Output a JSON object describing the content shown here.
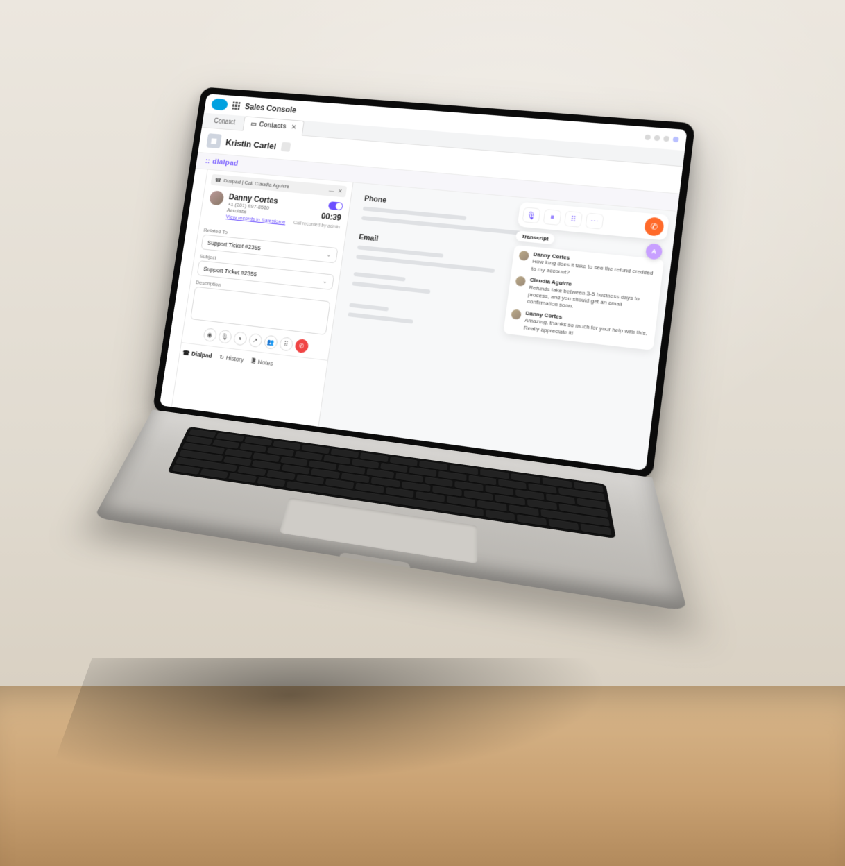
{
  "header": {
    "app_title": "Sales Console",
    "breadcrumb_label": "Conatct",
    "contact_name": "Kristin Carlel",
    "brand": "dialpad"
  },
  "tabs": {
    "active_label": "Contacts",
    "active_icon": "contact-card"
  },
  "cti": {
    "chip_label": "Dialpad | Call Claudia Aguirre",
    "caller_name": "Danny Cortes",
    "caller_phone": "+1 (201) 897-8510",
    "caller_company": "Aerolabs",
    "records_link": "View records in Salesforce",
    "timer": "00:39",
    "recorded_caption": "Call recorded by admin",
    "related_to_label": "Related To",
    "related_to_value": "Support Ticket #2355",
    "subject_label": "Subject",
    "subject_value": "Support Ticket #2355",
    "description_label": "Description",
    "bottom": {
      "dialpad": "Dialpad",
      "history": "History",
      "notes": "Notes"
    }
  },
  "center": {
    "phone_label": "Phone",
    "email_label": "Email"
  },
  "widget": {
    "transcript_label": "Transcript",
    "items": [
      {
        "name": "Danny Cortes",
        "text": "How long does it take to see the refund credited to my account?"
      },
      {
        "name": "Claudia Aguirre",
        "text": "Refunds take between 3-5 business days to process, and you should get an email confirmation soon."
      },
      {
        "name": "Danny Cortes",
        "text": "Amazing, thanks so much for your help with this. Really appreciate it!"
      }
    ]
  }
}
